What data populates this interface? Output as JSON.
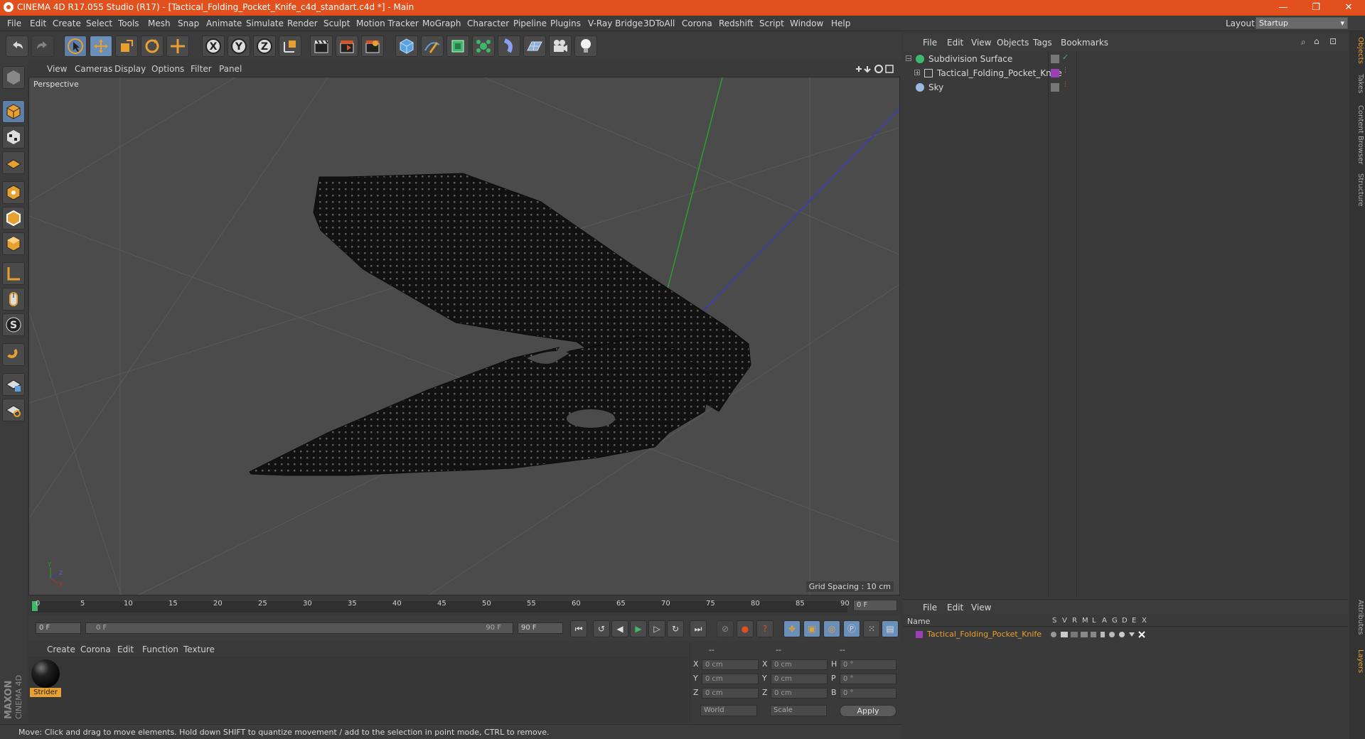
{
  "window": {
    "title": "CINEMA 4D R17.055 Studio (R17) - [Tactical_Folding_Pocket_Knife_c4d_standart.c4d *] - Main",
    "controls": [
      "—",
      "❐",
      "✕"
    ]
  },
  "menubar": {
    "items": [
      "File",
      "Edit",
      "Create",
      "Select",
      "Tools",
      "Mesh",
      "Snap",
      "Animate",
      "Simulate",
      "Render",
      "Sculpt",
      "Motion Tracker",
      "MoGraph",
      "Character",
      "Pipeline",
      "Plugins",
      "V-Ray Bridge",
      "3DToAll",
      "Corona",
      "Redshift",
      "Script",
      "Window",
      "Help"
    ],
    "layout_label": "Layout:",
    "layout_value": "Startup"
  },
  "toolbar": {
    "axis_labels": [
      "X",
      "Y",
      "Z"
    ]
  },
  "viewport": {
    "menu": [
      "View",
      "Cameras",
      "Display",
      "Options",
      "Filter",
      "Panel"
    ],
    "label": "Perspective",
    "grid_spacing": "Grid Spacing : 10 cm"
  },
  "timeline": {
    "ticks": [
      "0",
      "5",
      "10",
      "15",
      "20",
      "25",
      "30",
      "35",
      "40",
      "45",
      "50",
      "55",
      "60",
      "65",
      "70",
      "75",
      "80",
      "85",
      "90"
    ],
    "current_frame": "0 F",
    "start_frame": "0 F",
    "range_start": "0 F",
    "range_end": "90 F",
    "end_frame": "90 F"
  },
  "materials": {
    "menu": [
      "Create",
      "Corona",
      "Edit",
      "Function",
      "Texture"
    ],
    "items": [
      {
        "name": "Strider"
      }
    ]
  },
  "coordinates": {
    "headers": [
      "--",
      "--",
      "--"
    ],
    "rows": [
      {
        "l1": "X",
        "v1": "0 cm",
        "l2": "X",
        "v2": "0 cm",
        "l3": "H",
        "v3": "0 °"
      },
      {
        "l1": "Y",
        "v1": "0 cm",
        "l2": "Y",
        "v2": "0 cm",
        "l3": "P",
        "v3": "0 °"
      },
      {
        "l1": "Z",
        "v1": "0 cm",
        "l2": "Z",
        "v2": "0 cm",
        "l3": "B",
        "v3": "0 °"
      }
    ],
    "world": "World",
    "scale": "Scale",
    "apply": "Apply"
  },
  "object_manager": {
    "menu": [
      "File",
      "Edit",
      "View",
      "Objects",
      "Tags",
      "Bookmarks"
    ],
    "objects": [
      {
        "name": "Subdivision Surface"
      },
      {
        "name": "Tactical_Folding_Pocket_Knife"
      },
      {
        "name": "Sky"
      }
    ]
  },
  "layer_manager": {
    "menu": [
      "File",
      "Edit",
      "View"
    ],
    "header_name": "Name",
    "columns": [
      "S",
      "V",
      "R",
      "M",
      "L",
      "A",
      "G",
      "D",
      "E",
      "X"
    ],
    "layers": [
      {
        "name": "Tactical_Folding_Pocket_Knife"
      }
    ]
  },
  "side_tabs": [
    "Objects",
    "Takes",
    "Content Browser",
    "Structure",
    "Attributes",
    "Layers"
  ],
  "statusbar": {
    "text": "Move: Click and drag to move elements. Hold down SHIFT to quantize movement / add to the selection in point mode, CTRL to remove."
  },
  "brand": {
    "line1": "MAXON",
    "line2": "CINEMA 4D"
  },
  "colors": {
    "accent": "#e2511d",
    "layer": "#9b3fb5",
    "active_tool": "#6a8fb8"
  }
}
